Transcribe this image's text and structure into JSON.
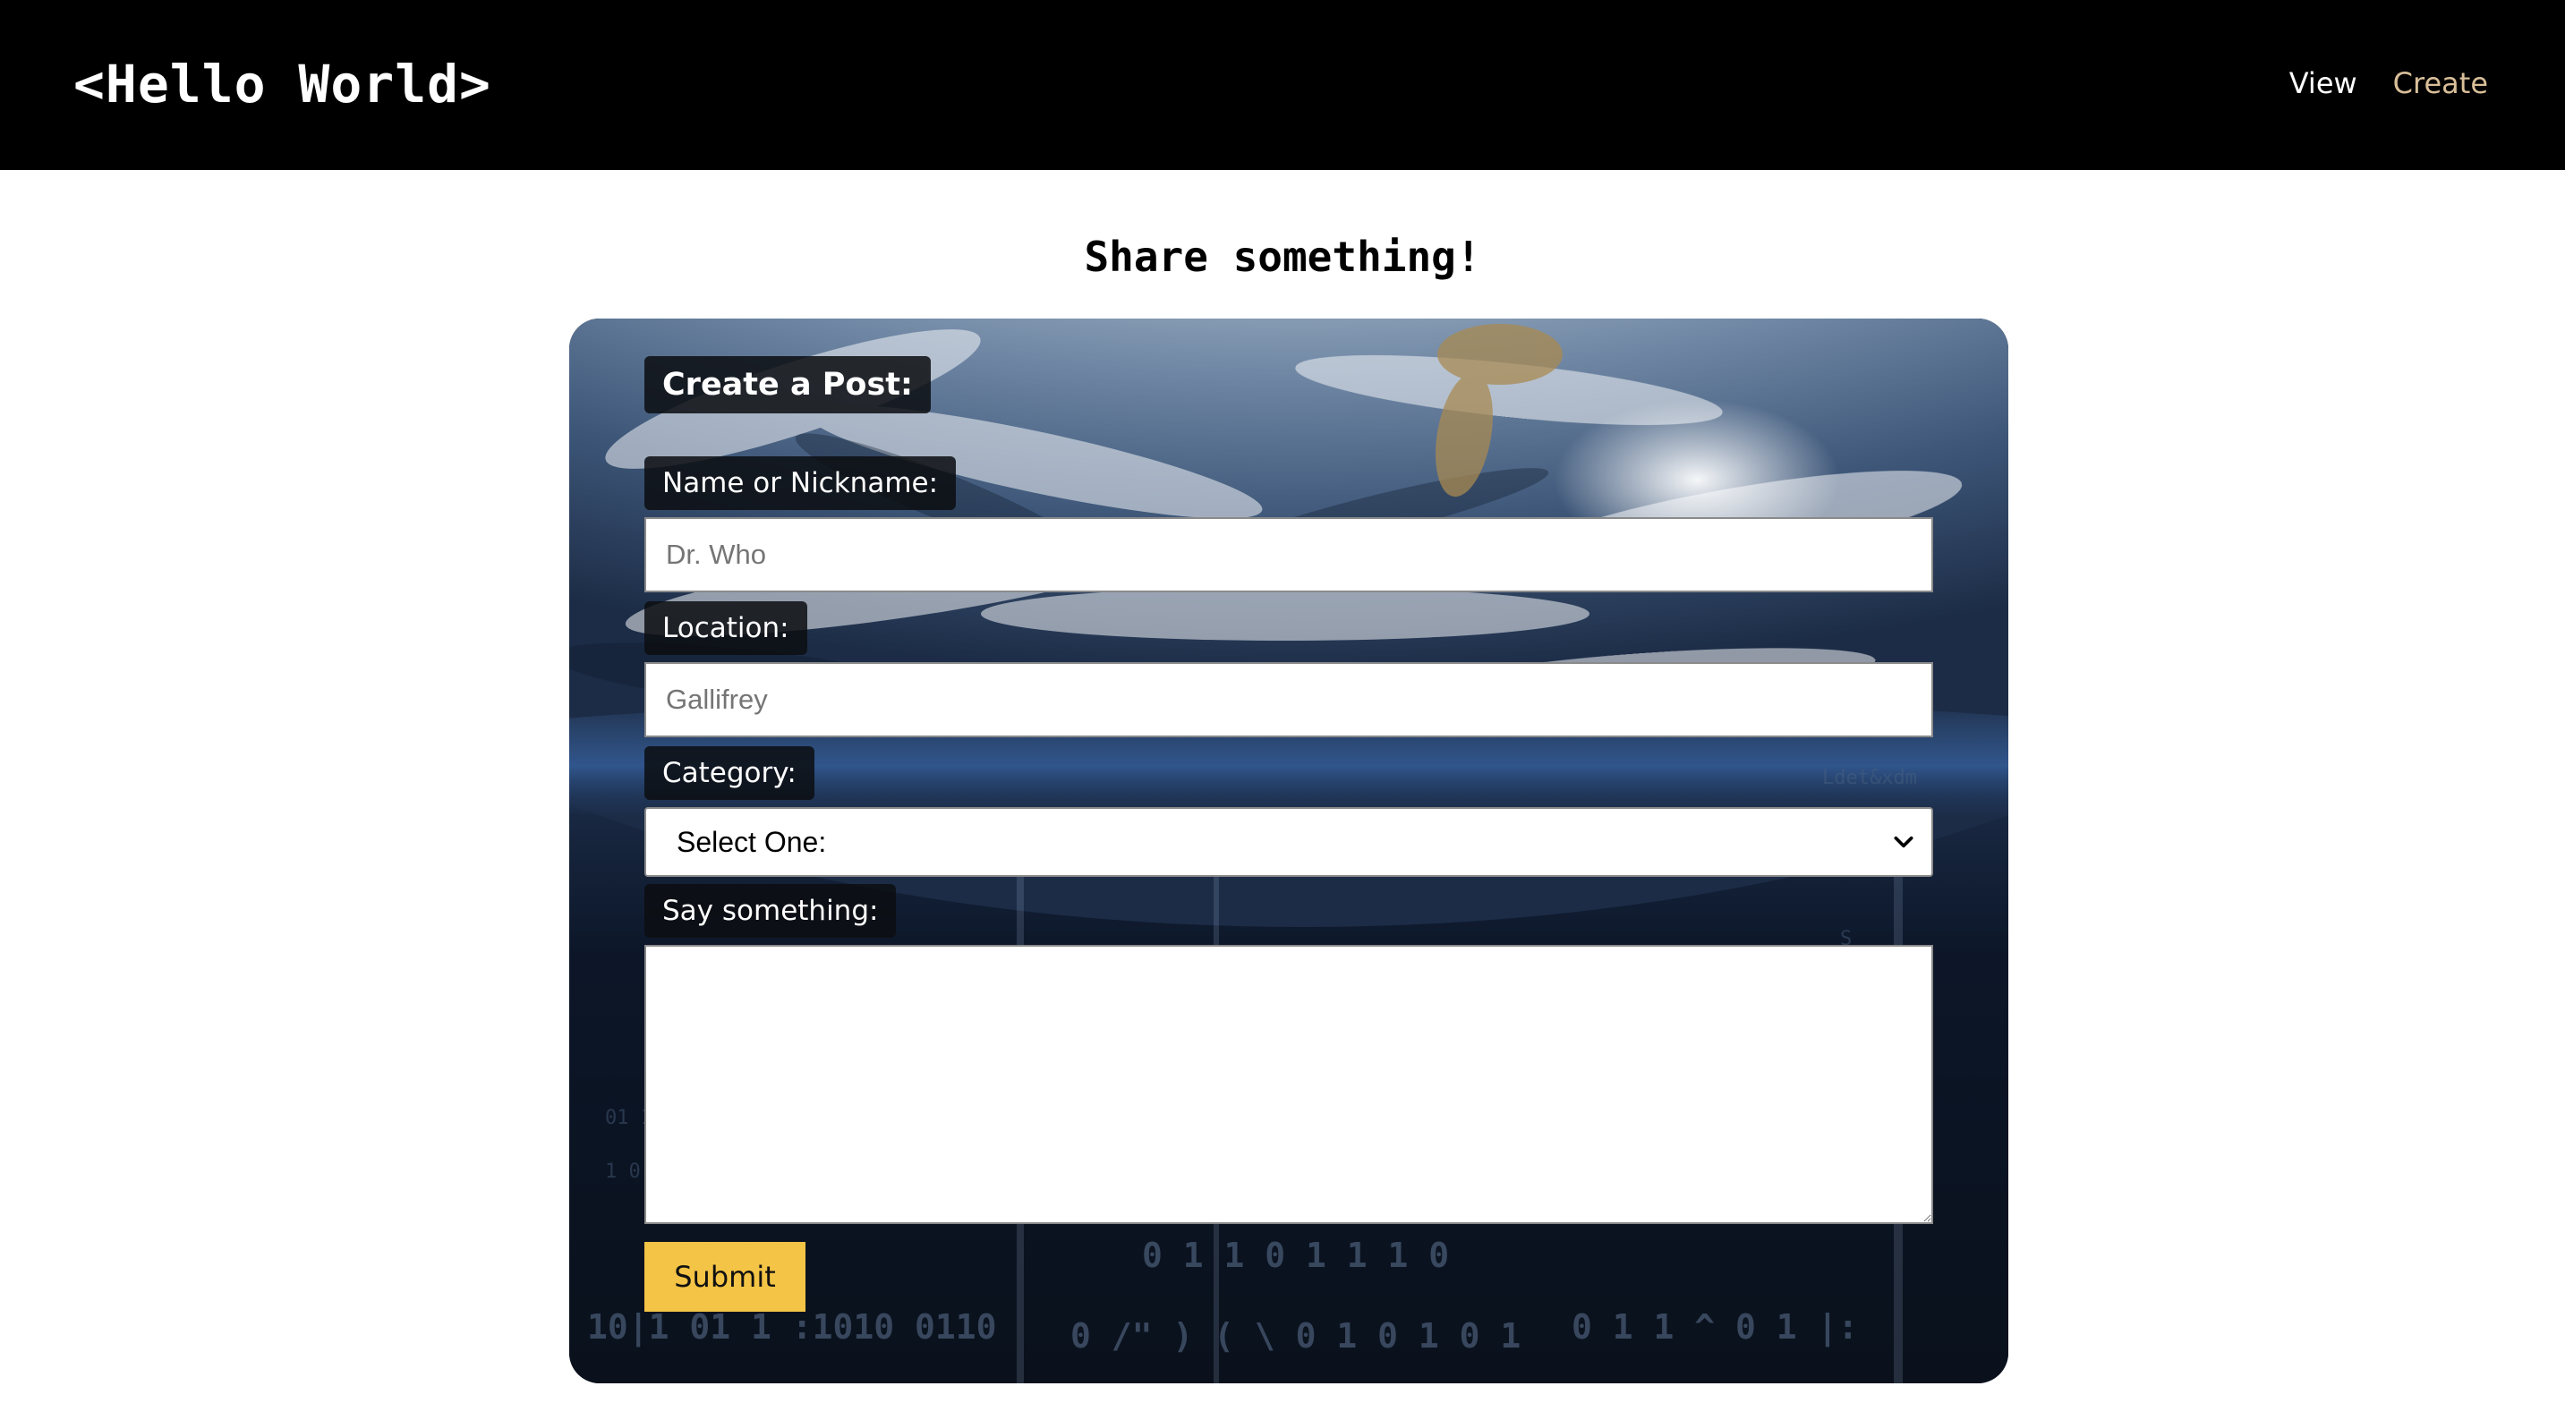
{
  "navbar": {
    "brand": "<Hello World>",
    "links": [
      {
        "label": "View",
        "color": "#ffffff"
      },
      {
        "label": "Create",
        "color": "#d9bf99"
      }
    ]
  },
  "page": {
    "heading": "Share something!"
  },
  "form": {
    "title": "Create a Post:",
    "name": {
      "label": "Name or Nickname:",
      "placeholder": "Dr. Who",
      "value": ""
    },
    "location": {
      "label": "Location:",
      "placeholder": "Gallifrey",
      "value": ""
    },
    "category": {
      "label": "Category:",
      "selected": "Select One:",
      "icon": "chevron-down-icon"
    },
    "message": {
      "label": "Say something:",
      "value": ""
    },
    "submit_label": "Submit"
  },
  "colors": {
    "nav_background": "#000000",
    "submit_background": "#f3c445",
    "label_chip_background": "#0c0e12",
    "active_link": "#d9bf99"
  }
}
